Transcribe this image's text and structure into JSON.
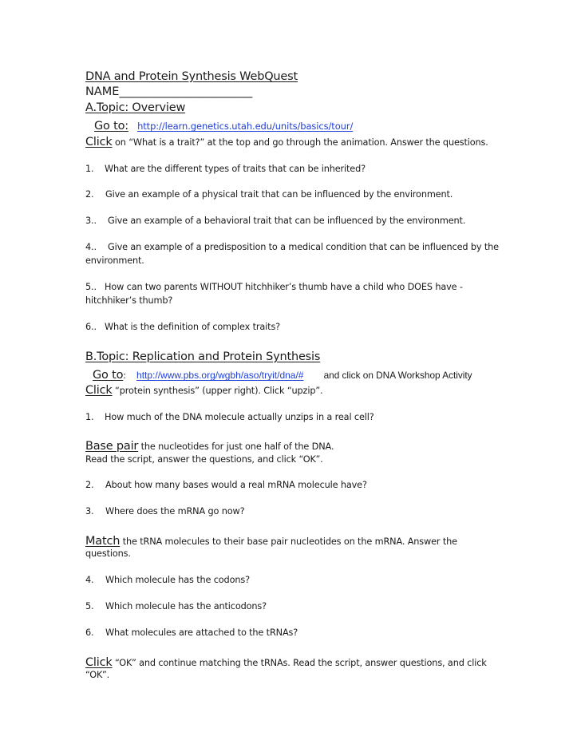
{
  "document": {
    "title": "DNA and Protein Synthesis WebQuest",
    "name_label": "NAME_______________________",
    "section_a": {
      "heading": "A.Topic:   Overview",
      "goto_label": "Go to:",
      "goto_link": "http://learn.genetics.utah.edu/units/basics/tour/",
      "click_label": "Click",
      "click_text": " on “What is a trait?” at the top and go through the animation.  Answer the questions.",
      "questions": [
        {
          "num": "1.",
          "text": "What are the different types of traits that can be inherited?"
        },
        {
          "num": "2.",
          "text": "Give an example of a physical trait that can be influenced by the environment."
        },
        {
          "num": "3..",
          "text": "Give an example of a behavioral trait that can be influenced by the environment."
        },
        {
          "num": "4..",
          "text": "Give an example of a predisposition to a medical condition that can be influenced by the",
          "cont": "environment."
        },
        {
          "num": "5..",
          "text": "How can two parents WITHOUT hitchhiker’s thumb have a child who DOES have -",
          "cont": "hitchhiker’s thumb?"
        },
        {
          "num": "6..",
          "text": "What is the definition of complex traits?"
        }
      ]
    },
    "section_b": {
      "heading": "B.Topic:  Replication and Protein Synthesis",
      "goto_label": "Go to",
      "goto_colon": ":",
      "goto_link": "http://www.pbs.org/wgbh/aso/tryit/dna/#",
      "goto_after": "and click on DNA Workshop Activity",
      "click_label": "Click",
      "click_text": " “protein synthesis” (upper right).    Click “upzip”.",
      "q1": {
        "num": "1.",
        "text": "How much of the DNA molecule actually unzips in a real cell?"
      },
      "base_pair_label": "Base pair",
      "base_pair_text": " the nucleotides for just one half of the DNA.",
      "read_script": "Read the script, answer the questions, and click “OK”.",
      "q2": {
        "num": "2.",
        "text": "About how many bases would a real mRNA molecule have?"
      },
      "q3": {
        "num": "3.",
        "text": "Where does the mRNA go now?"
      },
      "match_label": "Match",
      "match_text": " the tRNA molecules to their base pair nucleotides on the mRNA.   Answer the",
      "match_cont": "questions.",
      "q4": {
        "num": "4.",
        "text": "Which molecule has the codons?"
      },
      "q5": {
        "num": "5.",
        "text": "Which molecule has the anticodons?"
      },
      "q6": {
        "num": "6.",
        "text": "What molecules are attached to the tRNAs?"
      },
      "final_click_label": "Click",
      "final_click_text": " “OK” and continue matching the tRNAs.   Read the script, answer questions, and click",
      "final_click_cont": "“OK”."
    },
    "colors": {
      "link": "#1f3fd6",
      "text": "#1a1a1a"
    }
  }
}
